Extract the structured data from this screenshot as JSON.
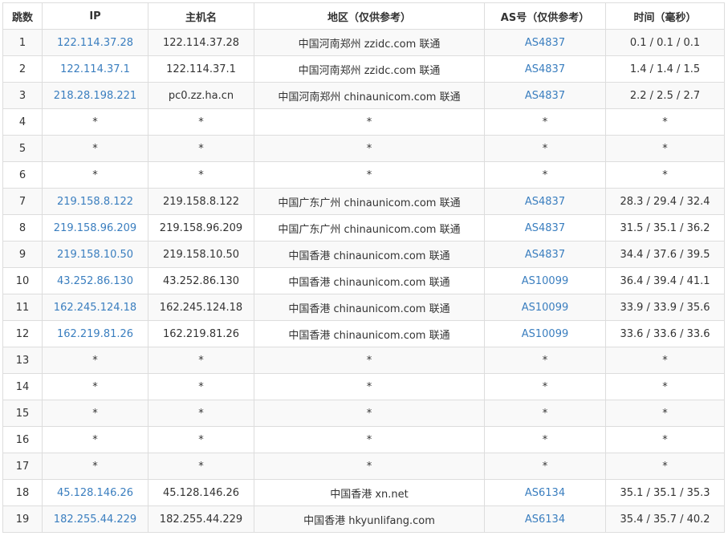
{
  "headers": [
    "跳数",
    "IP",
    "主机名",
    "地区（仅供参考）",
    "AS号（仅供参考）",
    "时间（毫秒）"
  ],
  "rows": [
    {
      "hop": "1",
      "ip": "122.114.37.28",
      "host": "122.114.37.28",
      "region": "中国河南郑州 zzidc.com 联通",
      "as": "AS4837",
      "time": "0.1 / 0.1 / 0.1"
    },
    {
      "hop": "2",
      "ip": "122.114.37.1",
      "host": "122.114.37.1",
      "region": "中国河南郑州 zzidc.com 联通",
      "as": "AS4837",
      "time": "1.4 / 1.4 / 1.5"
    },
    {
      "hop": "3",
      "ip": "218.28.198.221",
      "host": "pc0.zz.ha.cn",
      "region": "中国河南郑州 chinaunicom.com 联通",
      "as": "AS4837",
      "time": "2.2 / 2.5 / 2.7"
    },
    {
      "hop": "4",
      "ip": "*",
      "host": "*",
      "region": "*",
      "as": "*",
      "time": "*"
    },
    {
      "hop": "5",
      "ip": "*",
      "host": "*",
      "region": "*",
      "as": "*",
      "time": "*"
    },
    {
      "hop": "6",
      "ip": "*",
      "host": "*",
      "region": "*",
      "as": "*",
      "time": "*"
    },
    {
      "hop": "7",
      "ip": "219.158.8.122",
      "host": "219.158.8.122",
      "region": "中国广东广州 chinaunicom.com 联通",
      "as": "AS4837",
      "time": "28.3 / 29.4 / 32.4"
    },
    {
      "hop": "8",
      "ip": "219.158.96.209",
      "host": "219.158.96.209",
      "region": "中国广东广州 chinaunicom.com 联通",
      "as": "AS4837",
      "time": "31.5 / 35.1 / 36.2"
    },
    {
      "hop": "9",
      "ip": "219.158.10.50",
      "host": "219.158.10.50",
      "region": "中国香港 chinaunicom.com 联通",
      "as": "AS4837",
      "time": "34.4 / 37.6 / 39.5"
    },
    {
      "hop": "10",
      "ip": "43.252.86.130",
      "host": "43.252.86.130",
      "region": "中国香港 chinaunicom.com 联通",
      "as": "AS10099",
      "time": "36.4 / 39.4 / 41.1"
    },
    {
      "hop": "11",
      "ip": "162.245.124.18",
      "host": "162.245.124.18",
      "region": "中国香港 chinaunicom.com 联通",
      "as": "AS10099",
      "time": "33.9 / 33.9 / 35.6"
    },
    {
      "hop": "12",
      "ip": "162.219.81.26",
      "host": "162.219.81.26",
      "region": "中国香港 chinaunicom.com 联通",
      "as": "AS10099",
      "time": "33.6 / 33.6 / 33.6"
    },
    {
      "hop": "13",
      "ip": "*",
      "host": "*",
      "region": "*",
      "as": "*",
      "time": "*"
    },
    {
      "hop": "14",
      "ip": "*",
      "host": "*",
      "region": "*",
      "as": "*",
      "time": "*"
    },
    {
      "hop": "15",
      "ip": "*",
      "host": "*",
      "region": "*",
      "as": "*",
      "time": "*"
    },
    {
      "hop": "16",
      "ip": "*",
      "host": "*",
      "region": "*",
      "as": "*",
      "time": "*"
    },
    {
      "hop": "17",
      "ip": "*",
      "host": "*",
      "region": "*",
      "as": "*",
      "time": "*"
    },
    {
      "hop": "18",
      "ip": "45.128.146.26",
      "host": "45.128.146.26",
      "region": "中国香港 xn.net",
      "as": "AS6134",
      "time": "35.1 / 35.1 / 35.3"
    },
    {
      "hop": "19",
      "ip": "182.255.44.229",
      "host": "182.255.44.229",
      "region": "中国香港 hkyunlifang.com",
      "as": "AS6134",
      "time": "35.4 / 35.7 / 40.2"
    }
  ],
  "colors": {
    "link": "#3a7ebf",
    "text": "#333333",
    "border": "#dddddd",
    "stripe": "#f9f9f9"
  }
}
